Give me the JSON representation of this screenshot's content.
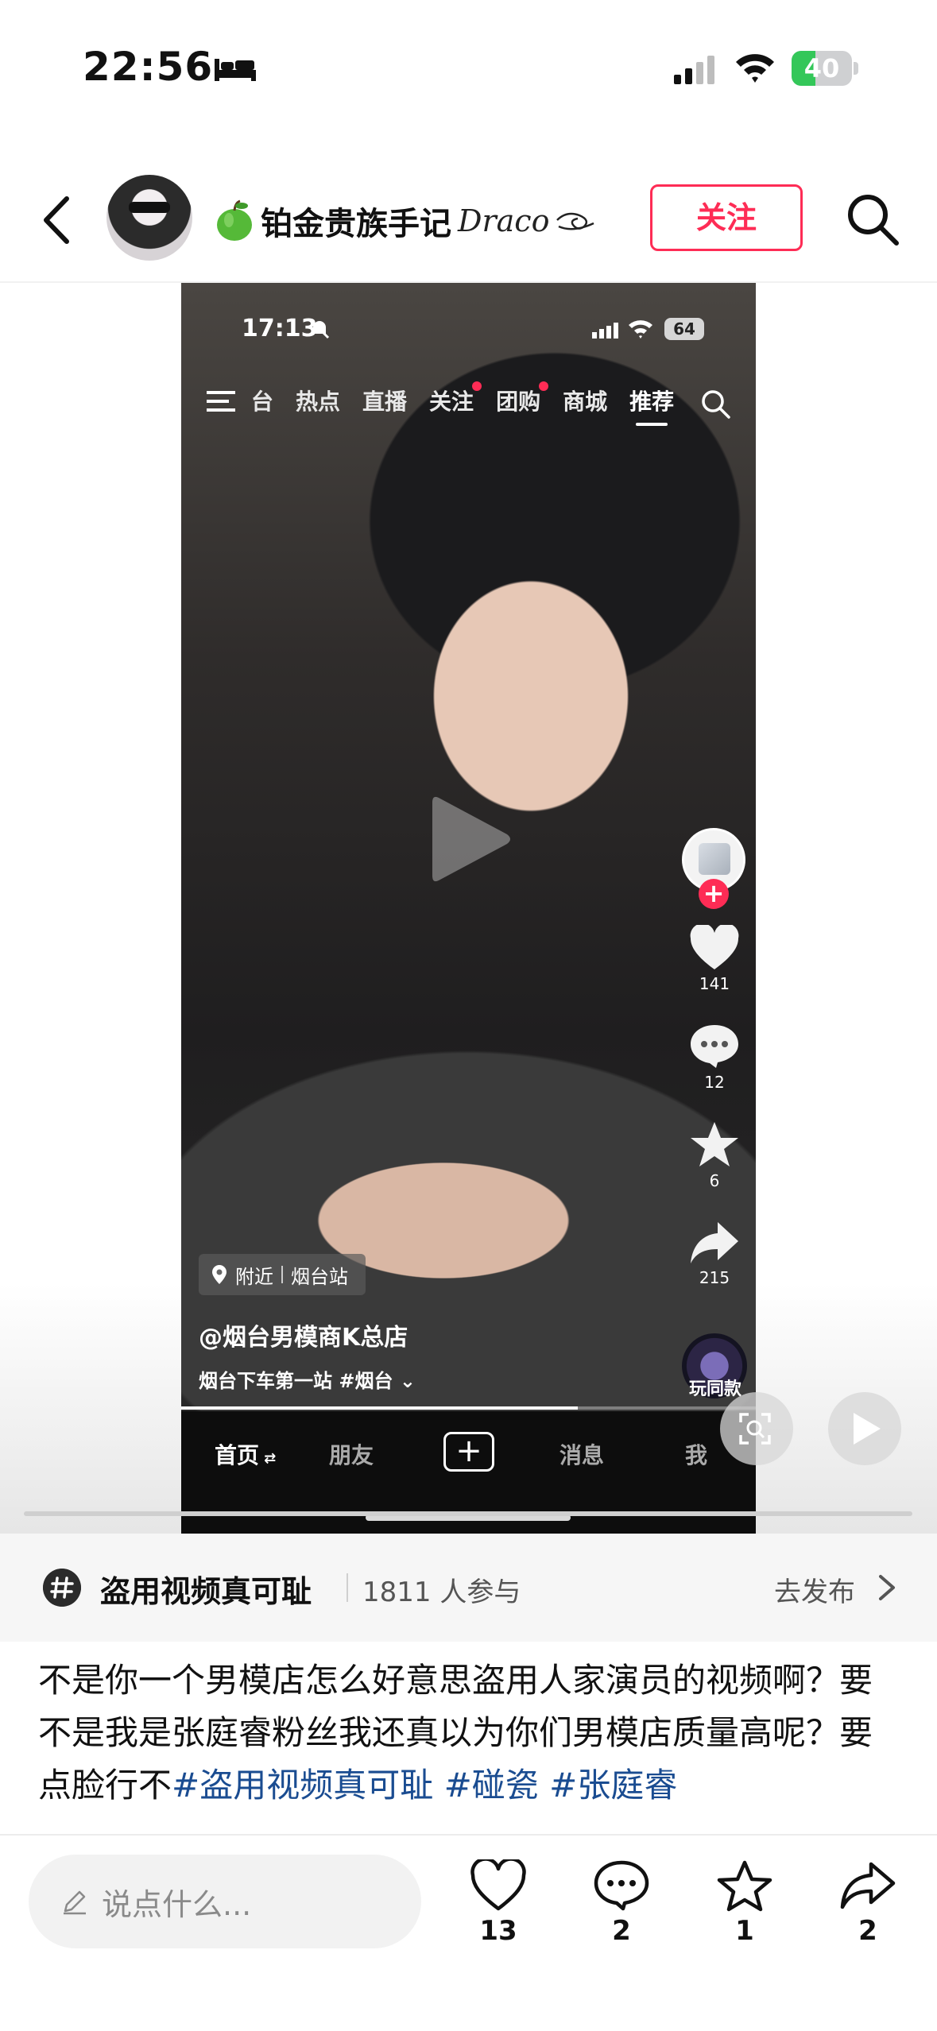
{
  "status_bar": {
    "time": "22:56",
    "battery": "40",
    "battery_level": 0.4,
    "icons": [
      "bed-icon",
      "signal-icon",
      "wifi-icon",
      "battery-charging-icon"
    ]
  },
  "header": {
    "author_name": "铂金贵族手记",
    "author_suffix": "Draco",
    "follow_label": "关注",
    "icons": [
      "back-icon",
      "avatar",
      "apple-emoji-icon",
      "swirl-icon",
      "search-icon"
    ]
  },
  "video": {
    "inner_status": {
      "time": "17:13",
      "battery": "64"
    },
    "tabs": [
      {
        "label": "台",
        "dot": false
      },
      {
        "label": "热点",
        "dot": false
      },
      {
        "label": "直播",
        "dot": false
      },
      {
        "label": "关注",
        "dot": true
      },
      {
        "label": "团购",
        "dot": true
      },
      {
        "label": "商城",
        "dot": false
      },
      {
        "label": "推荐",
        "dot": false,
        "active": true
      }
    ],
    "rail": {
      "likes": "141",
      "comments": "12",
      "favorites": "6",
      "shares": "215",
      "music_label": "玩同款"
    },
    "location": {
      "prefix": "附近",
      "place": "烟台站"
    },
    "author": "@烟台男模商K总店",
    "caption": "烟台下车第一站 #烟台",
    "progress": 0.69,
    "tabbar": {
      "home": "首页",
      "friends": "朋友",
      "messages": "消息",
      "me": "我"
    },
    "accent": "#fe2c55"
  },
  "topic": {
    "title": "盗用视频真可耻",
    "participants": "1811 人参与",
    "action": "去发布"
  },
  "description": {
    "text": "不是你一个男模店怎么好意思盗用人家演员的视频啊？要不是我是张庭睿粉丝我还真以为你们男模店质量高呢？要点脸行不",
    "hashtags": [
      "#盗用视频真可耻",
      "#碰瓷",
      "#张庭睿"
    ],
    "hashtag_color": "#1a4c91"
  },
  "bottom_bar": {
    "comment_placeholder": "说点什么...",
    "likes": "13",
    "comments": "2",
    "favorites": "1",
    "shares": "2"
  }
}
